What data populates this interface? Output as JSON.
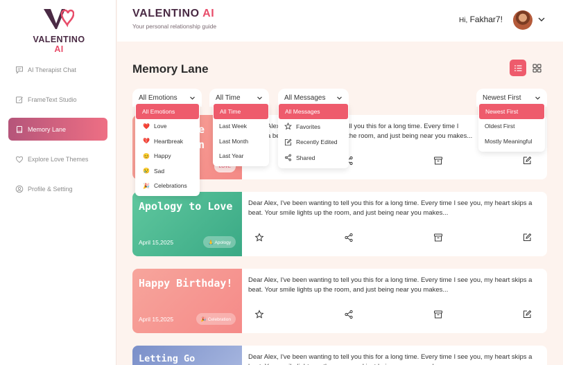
{
  "sidebar": {
    "logo": {
      "name": "VALENTINO",
      "ai": "AI"
    },
    "items": [
      {
        "label": "AI Therapist Chat",
        "icon": "chat-icon"
      },
      {
        "label": "FrameText Studio",
        "icon": "edit-icon"
      },
      {
        "label": "Memory Lane",
        "icon": "book-icon",
        "active": true
      },
      {
        "label": "Explore Love Themes",
        "icon": "heart-icon"
      },
      {
        "label": "Profile & Setting",
        "icon": "user-circle-icon"
      }
    ]
  },
  "header": {
    "title": "VALENTINO",
    "title_ai": "AI",
    "subtitle": "Your personal relationship guide",
    "greeting_hi": "Hi,",
    "greeting_name": "Fakhar7!"
  },
  "main": {
    "page_title": "Memory Lane",
    "filters": {
      "emotions": {
        "label": "All Emotions",
        "options": [
          {
            "label": "All Emotions",
            "icon": ""
          },
          {
            "label": "Love",
            "icon": "❤️"
          },
          {
            "label": "Heartbreak",
            "icon": "💔"
          },
          {
            "label": "Happy",
            "icon": "😊"
          },
          {
            "label": "Sad",
            "icon": "😢"
          },
          {
            "label": "Celebrations",
            "icon": "🎉"
          }
        ]
      },
      "time": {
        "label": "All Time",
        "options": [
          "All Time",
          "Last Week",
          "Last Month",
          "Last Year"
        ]
      },
      "messages": {
        "label": "All Messages",
        "options": [
          {
            "label": "All Messages",
            "icon": ""
          },
          {
            "label": "Favorites",
            "icon": "star-icon"
          },
          {
            "label": "Recently Edited",
            "icon": "edit-icon"
          },
          {
            "label": "Shared",
            "icon": "share-icon"
          }
        ]
      },
      "sort": {
        "label": "Newest First",
        "options": [
          "Newest First",
          "Oldest First",
          "Mostly Meaningful"
        ]
      }
    },
    "cards": [
      {
        "title": "Love Note",
        "date": "",
        "tag": "LOVE",
        "text": "Dear Alex, I've been wanting to tell you this for a long time. Every time I see you, my heart skips a beat. Your smile lights up the room, and just being near you makes...",
        "text_visible_1": "Alex, I've been wanting to tell you this for a long time. Every time I",
        "text_visible_2": "a beat. Your smile lights up the room, and just being near you makes..."
      },
      {
        "title": "Apology to Love",
        "date": "April 15,2025",
        "tag": "🙏 Apology",
        "text": "Dear Alex, I've been wanting to tell you this for a long time. Every time I see you, my heart skips a beat. Your smile lights up the room, and just being near you makes..."
      },
      {
        "title": "Happy Birthday!",
        "date": "April 15,2025",
        "tag": "🎉 Celebration",
        "text": "Dear Alex, I've been wanting to tell you this for a long time. Every time I see you, my heart skips a beat. Your smile lights up the room, and just being near you makes..."
      },
      {
        "title": "Letting Go",
        "date": "",
        "tag": "",
        "text": "Dear Alex, I've been wanting to tell you this for a long time. Every time I see you, my heart skips a beat. Your smile lights up the room, and just being near you makes..."
      }
    ]
  },
  "colors": {
    "accent": "#ee5b6c",
    "brand_dark": "#4a2a44",
    "background": "#fdf3ee"
  }
}
